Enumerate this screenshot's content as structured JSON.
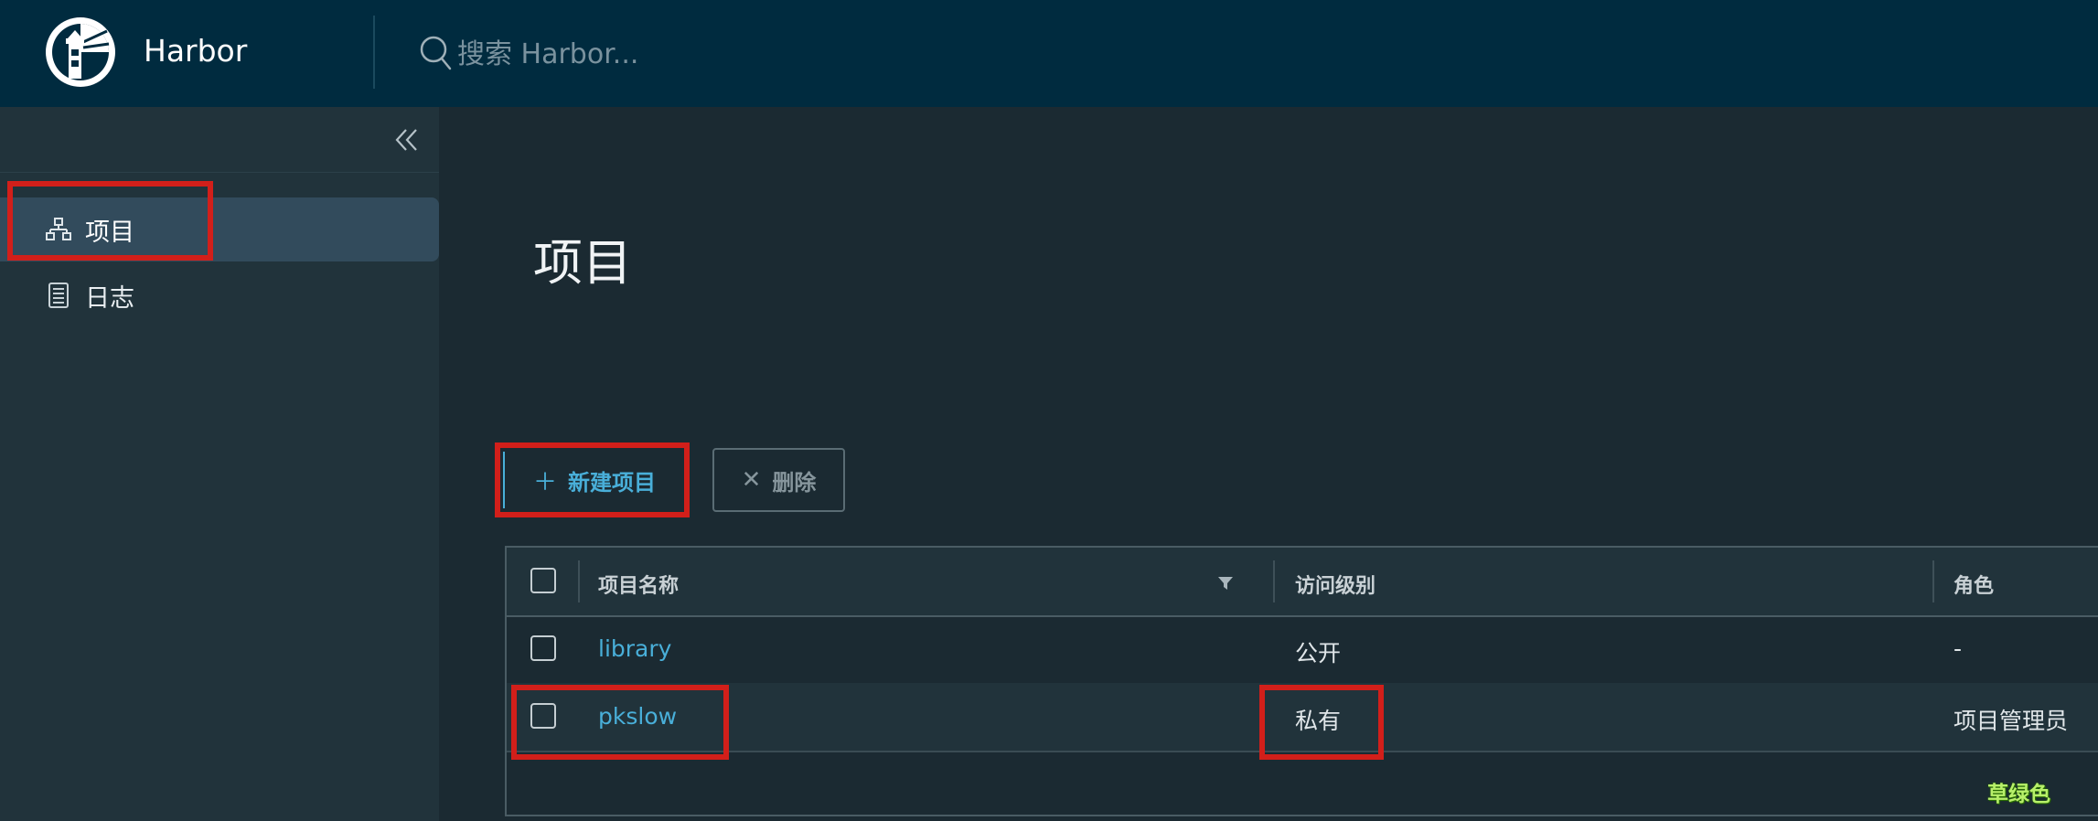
{
  "header": {
    "app_title": "Harbor",
    "search_placeholder": "搜索 Harbor..."
  },
  "sidebar": {
    "items": [
      {
        "label": "项目",
        "icon": "projects-icon",
        "active": true
      },
      {
        "label": "日志",
        "icon": "logs-icon",
        "active": false
      }
    ]
  },
  "main": {
    "title": "项目",
    "toolbar": {
      "new_label": "新建项目",
      "delete_label": "删除"
    },
    "table": {
      "headers": [
        "项目名称",
        "访问级别",
        "角色"
      ],
      "rows": [
        {
          "name": "library",
          "access": "公开",
          "role": "-"
        },
        {
          "name": "pkslow",
          "access": "私有",
          "role": "项目管理员"
        }
      ]
    }
  },
  "watermark": "草绿色",
  "colors": {
    "header_bg": "#002b3f",
    "accent": "#49afd9",
    "highlight": "#d21f1a"
  }
}
